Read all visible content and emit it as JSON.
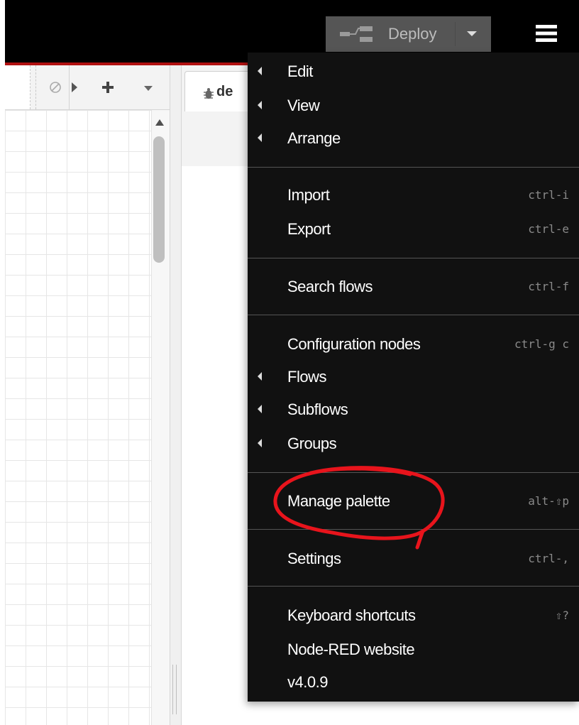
{
  "header": {
    "deploy_label": "Deploy",
    "deploy_icon": "deploy-flow-icon",
    "menu_icon": "hamburger-menu-icon",
    "background": "#000000",
    "accent": "#b01010"
  },
  "sidebar": {
    "tab_label": "de",
    "tab_icon": "bug-icon"
  },
  "menu": {
    "background": "#111111",
    "items": [
      {
        "label": "Edit",
        "submenu": true,
        "shortcut": ""
      },
      {
        "label": "View",
        "submenu": true,
        "shortcut": ""
      },
      {
        "label": "Arrange",
        "submenu": true,
        "shortcut": ""
      },
      {
        "label": "Import",
        "submenu": false,
        "shortcut": "ctrl-i"
      },
      {
        "label": "Export",
        "submenu": false,
        "shortcut": "ctrl-e"
      },
      {
        "label": "Search flows",
        "submenu": false,
        "shortcut": "ctrl-f"
      },
      {
        "label": "Configuration nodes",
        "submenu": false,
        "shortcut": "ctrl-g c"
      },
      {
        "label": "Flows",
        "submenu": true,
        "shortcut": ""
      },
      {
        "label": "Subflows",
        "submenu": true,
        "shortcut": ""
      },
      {
        "label": "Groups",
        "submenu": true,
        "shortcut": ""
      },
      {
        "label": "Manage palette",
        "submenu": false,
        "shortcut": "alt-⇧p"
      },
      {
        "label": "Settings",
        "submenu": false,
        "shortcut": "ctrl-,"
      },
      {
        "label": "Keyboard shortcuts",
        "submenu": false,
        "shortcut": "⇧?"
      },
      {
        "label": "Node-RED website",
        "submenu": false,
        "shortcut": ""
      },
      {
        "label": "v4.0.9",
        "submenu": false,
        "shortcut": ""
      }
    ]
  },
  "annotation": {
    "type": "hand-drawn-circle",
    "target": "Manage palette",
    "color": "#e8141c"
  }
}
